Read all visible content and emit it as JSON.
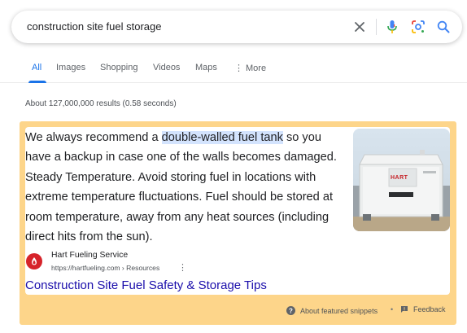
{
  "search": {
    "query": "construction site fuel storage"
  },
  "icons": {
    "clear": "close-icon",
    "mic": "microphone-icon",
    "lens": "lens-icon",
    "search": "search-icon"
  },
  "tabs": [
    {
      "label": "All",
      "active": true
    },
    {
      "label": "Images"
    },
    {
      "label": "Shopping"
    },
    {
      "label": "Videos"
    },
    {
      "label": "Maps"
    },
    {
      "label": "More"
    }
  ],
  "result_stats": "About 127,000,000 results (0.58 seconds)",
  "snippet": {
    "text_before": "We always recommend a ",
    "text_highlight": "double-walled fuel tank",
    "text_after": " so you have a backup in case one of the walls becomes damaged. Steady Temperature. Avoid storing fuel in locations with extreme temperature fluctuations. Fuel should be stored at room temperature, away from any heat sources (including direct hits from the sun).",
    "image_brand": "HART",
    "source_name": "Hart Fueling Service",
    "source_url": "https://hartfueling.com › Resources",
    "link_title": "Construction Site Fuel Safety & Storage Tips",
    "highlight_color": "#d3e3fd",
    "background_color": "#fdd58a"
  },
  "footer": {
    "about": "About featured snippets",
    "separator": "•",
    "feedback": "Feedback"
  },
  "colors": {
    "accent": "#1a73e8",
    "link": "#1a0dab"
  }
}
